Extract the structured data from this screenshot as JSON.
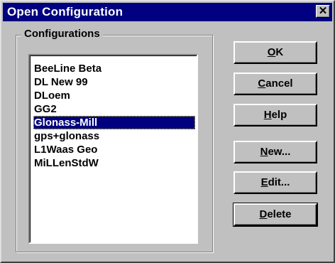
{
  "window": {
    "title": "Open Configuration",
    "close_glyph": "✕"
  },
  "group": {
    "label": "Configurations"
  },
  "list": {
    "items": [
      {
        "label": "BeeLine Beta"
      },
      {
        "label": "DL New 99"
      },
      {
        "label": "DLoem"
      },
      {
        "label": "GG2"
      },
      {
        "label": "Glonass-Mill",
        "selected": true
      },
      {
        "label": "gps+glonass"
      },
      {
        "label": "L1Waas Geo"
      },
      {
        "label": "MiLLenStdW"
      }
    ]
  },
  "buttons": {
    "ok": {
      "mnemonic": "O",
      "rest": "K"
    },
    "cancel": {
      "mnemonic": "C",
      "rest": "ancel"
    },
    "help": {
      "mnemonic": "H",
      "rest": "elp"
    },
    "new": {
      "mnemonic": "N",
      "rest": "ew..."
    },
    "edit": {
      "mnemonic": "E",
      "rest": "dit..."
    },
    "delete": {
      "mnemonic": "D",
      "rest": "elete"
    }
  },
  "colors": {
    "face": "#c0c0c0",
    "title_bar": "#000080",
    "selection": "#000080"
  }
}
